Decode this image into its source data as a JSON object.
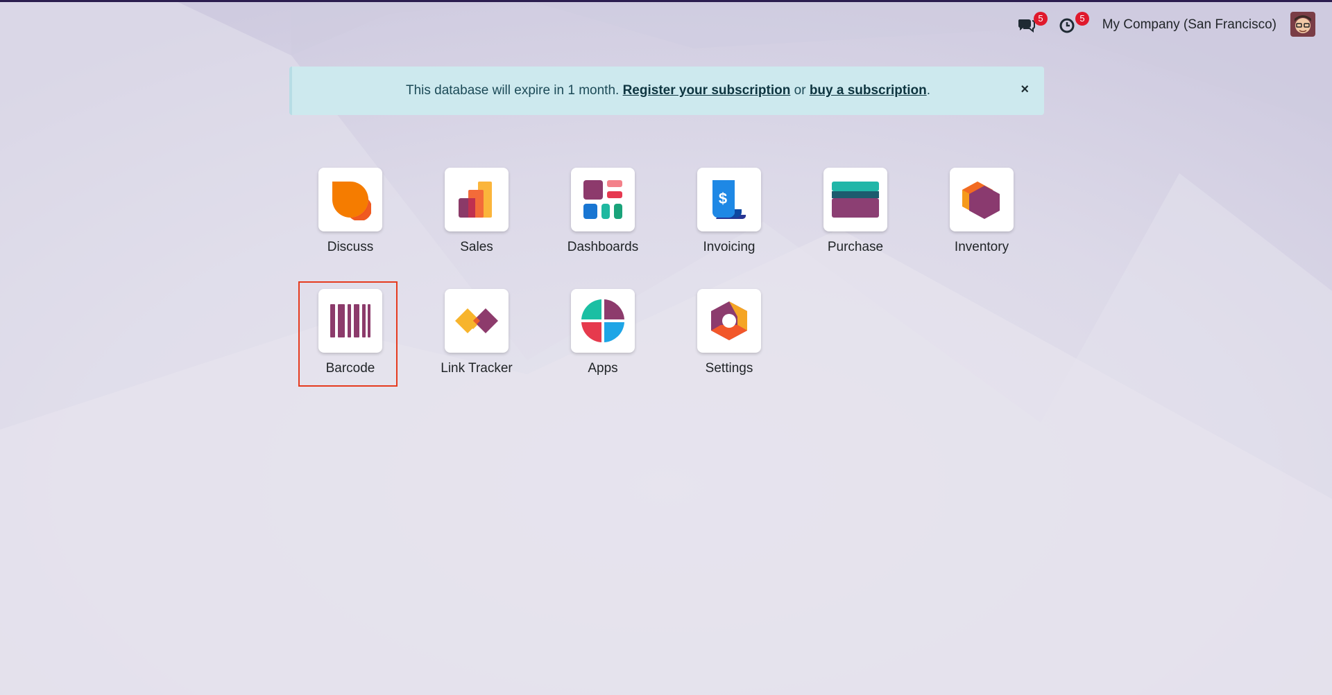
{
  "navbar": {
    "messages_count": "5",
    "activities_count": "5",
    "company": "My Company (San Francisco)"
  },
  "alert": {
    "text_before": "This database will expire in 1 month. ",
    "register_link": "Register your subscription",
    "text_middle": " or ",
    "buy_link": "buy a subscription",
    "text_after": ".",
    "close": "×"
  },
  "apps": [
    {
      "label": "Discuss",
      "icon": "discuss-icon"
    },
    {
      "label": "Sales",
      "icon": "sales-icon"
    },
    {
      "label": "Dashboards",
      "icon": "dashboards-icon"
    },
    {
      "label": "Invoicing",
      "icon": "invoicing-icon"
    },
    {
      "label": "Purchase",
      "icon": "purchase-icon"
    },
    {
      "label": "Inventory",
      "icon": "inventory-icon"
    },
    {
      "label": "Barcode",
      "icon": "barcode-icon"
    },
    {
      "label": "Link Tracker",
      "icon": "link-tracker-icon"
    },
    {
      "label": "Apps",
      "icon": "apps-icon"
    },
    {
      "label": "Settings",
      "icon": "settings-icon"
    }
  ],
  "colors": {
    "alert_bg": "#cde9ee",
    "badge": "#e0192c",
    "highlight": "#e53a1e"
  }
}
